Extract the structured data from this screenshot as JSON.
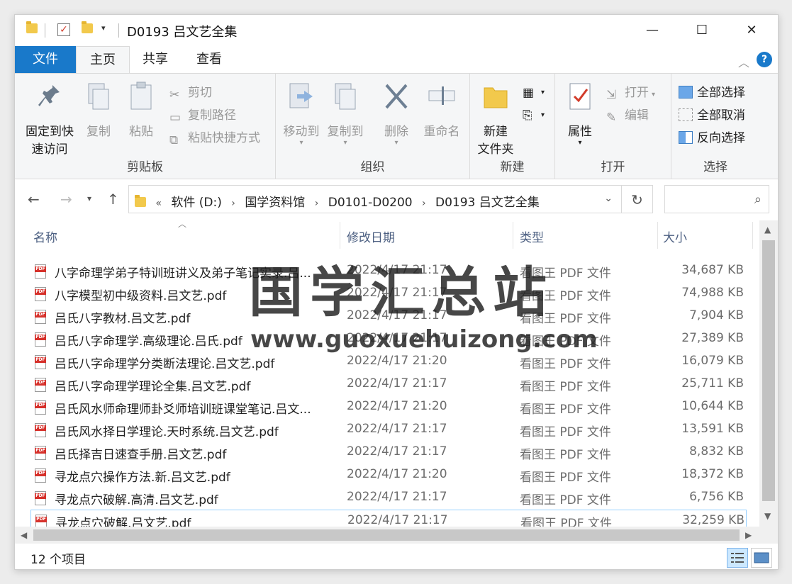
{
  "window": {
    "title": "D0193 吕文艺全集",
    "minimize": "—",
    "maximize": "☐",
    "close": "✕"
  },
  "tabs": [
    {
      "label": "文件"
    },
    {
      "label": "主页"
    },
    {
      "label": "共享"
    },
    {
      "label": "查看"
    }
  ],
  "ribbon": {
    "clipboard": {
      "label": "剪贴板",
      "pin_line1": "固定到快",
      "pin_line2": "速访问",
      "copy": "复制",
      "paste": "粘贴",
      "cut": "剪切",
      "copy_path": "复制路径",
      "paste_shortcut": "粘贴快捷方式"
    },
    "organize": {
      "label": "组织",
      "move_to": "移动到",
      "copy_to": "复制到",
      "delete": "删除",
      "rename": "重命名"
    },
    "new": {
      "label": "新建",
      "new_folder_line1": "新建",
      "new_folder_line2": "文件夹"
    },
    "open": {
      "label": "打开",
      "properties": "属性",
      "open": "打开",
      "edit": "编辑"
    },
    "select": {
      "label": "选择",
      "select_all": "全部选择",
      "select_none": "全部取消",
      "invert": "反向选择"
    }
  },
  "address": {
    "crumbs": [
      "软件 (D:)",
      "国学资料馆",
      "D0101-D0200",
      "D0193 吕文艺全集"
    ],
    "overflow": "«"
  },
  "columns": {
    "name": "名称",
    "date": "修改日期",
    "type": "类型",
    "size": "大小"
  },
  "files": [
    {
      "name": "八字命理学弟子特训班讲义及弟子笔记实录.吕...",
      "date": "2022/4/17 21:17",
      "type": "看图王 PDF 文件",
      "size": "34,687 KB"
    },
    {
      "name": "八字模型初中级资料.吕文艺.pdf",
      "date": "2022/4/17 21:17",
      "type": "看图王 PDF 文件",
      "size": "74,988 KB"
    },
    {
      "name": "吕氏八字教材.吕文艺.pdf",
      "date": "2022/4/17 21:17",
      "type": "看图王 PDF 文件",
      "size": "7,904 KB"
    },
    {
      "name": "吕氏八字命理学.高级理论.吕氏.pdf",
      "date": "2022/4/17 21:17",
      "type": "看图王 PDF 文件",
      "size": "27,389 KB"
    },
    {
      "name": "吕氏八字命理学分类断法理论.吕文艺.pdf",
      "date": "2022/4/17 21:20",
      "type": "看图王 PDF 文件",
      "size": "16,079 KB"
    },
    {
      "name": "吕氏八字命理学理论全集.吕文艺.pdf",
      "date": "2022/4/17 21:17",
      "type": "看图王 PDF 文件",
      "size": "25,711 KB"
    },
    {
      "name": "吕氏风水师命理师卦爻师培训班课堂笔记.吕文...",
      "date": "2022/4/17 21:20",
      "type": "看图王 PDF 文件",
      "size": "10,644 KB"
    },
    {
      "name": "吕氏风水择日学理论.天时系统.吕文艺.pdf",
      "date": "2022/4/17 21:17",
      "type": "看图王 PDF 文件",
      "size": "13,591 KB"
    },
    {
      "name": "吕氏择吉日速查手册.吕文艺.pdf",
      "date": "2022/4/17 21:17",
      "type": "看图王 PDF 文件",
      "size": "8,832 KB"
    },
    {
      "name": "寻龙点穴操作方法.新.吕文艺.pdf",
      "date": "2022/4/17 21:20",
      "type": "看图王 PDF 文件",
      "size": "18,372 KB"
    },
    {
      "name": "寻龙点穴破解.高清.吕文艺.pdf",
      "date": "2022/4/17 21:17",
      "type": "看图王 PDF 文件",
      "size": "6,756 KB"
    },
    {
      "name": "寻龙点穴破解.吕文艺.pdf",
      "date": "2022/4/17 21:17",
      "type": "看图王 PDF 文件",
      "size": "32,259 KB"
    }
  ],
  "status": {
    "count": "12 个项目"
  },
  "watermark": {
    "title": "国学汇总站",
    "url": "www.guoxuehuizong.com"
  },
  "colors": {
    "file_tab": "#1979ca",
    "selection_border": "#99d1ff",
    "header_text": "#4d6082"
  }
}
